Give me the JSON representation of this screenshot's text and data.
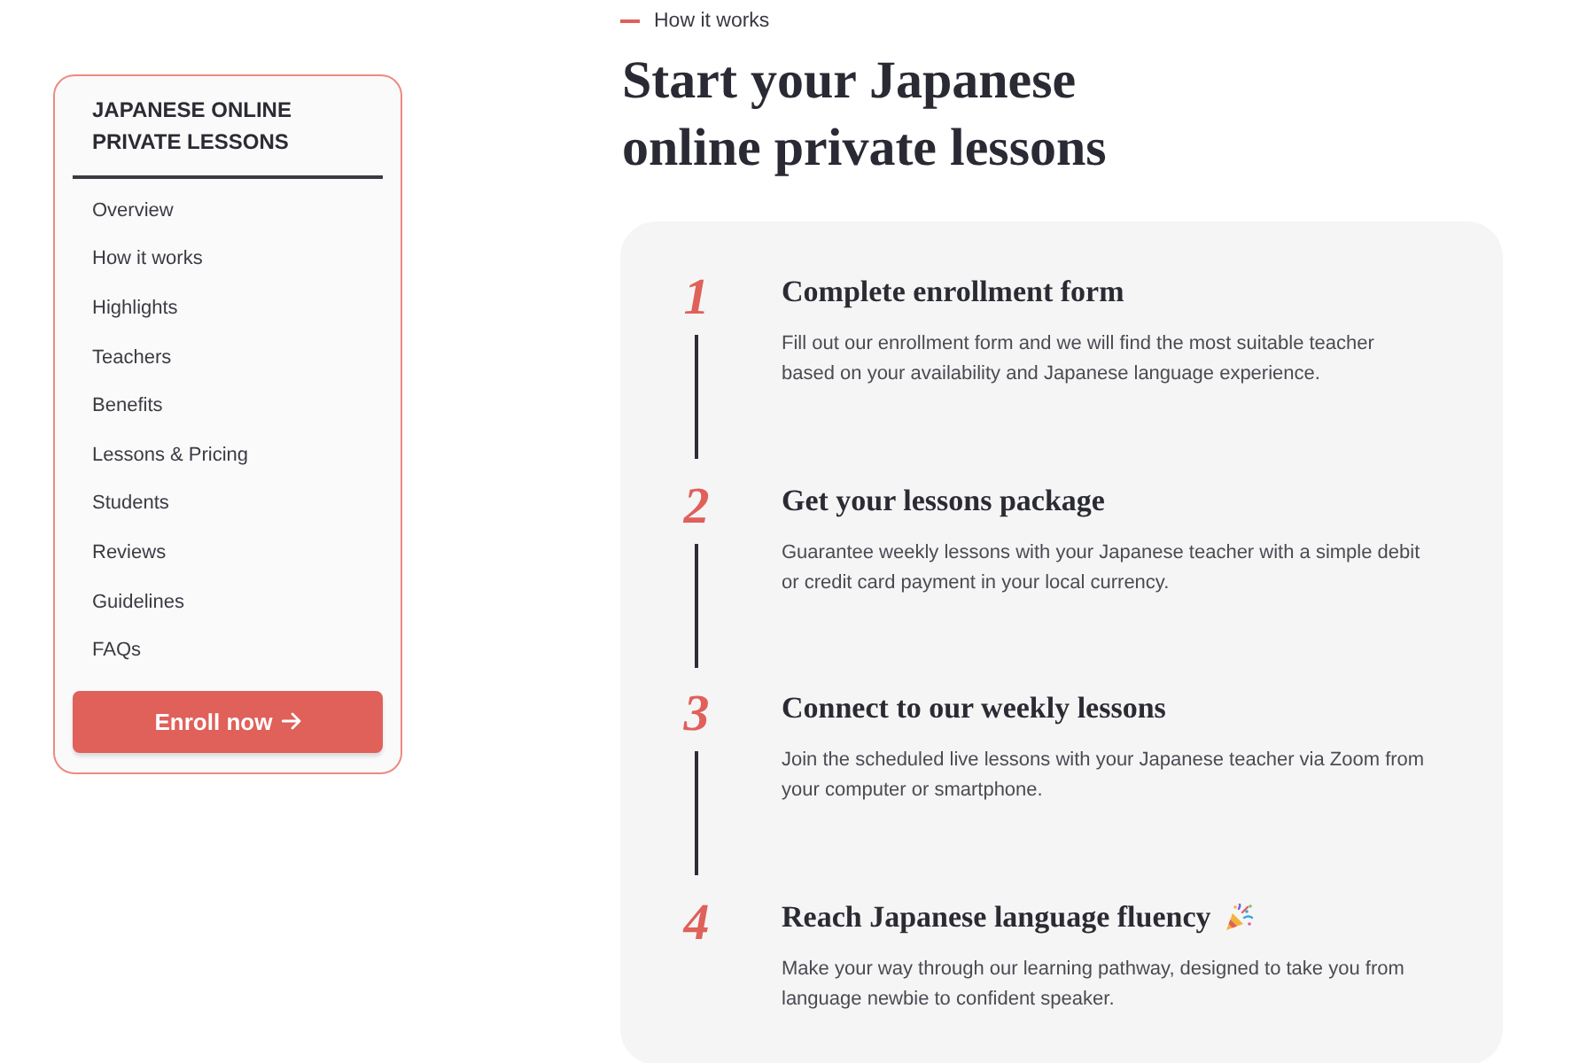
{
  "sidebar": {
    "title": "JAPANESE ONLINE PRIVATE LESSONS",
    "items": [
      "Overview",
      "How it works",
      "Highlights",
      "Teachers",
      "Benefits",
      "Lessons & Pricing",
      "Students",
      "Reviews",
      "Guidelines",
      "FAQs"
    ],
    "button": {
      "label": "Enroll now"
    }
  },
  "eyebrow": "How it works",
  "heading": "Start your Japanese online private lessons",
  "steps": [
    {
      "number": "1",
      "title": "Complete enrollment form",
      "description": "Fill out our enrollment form and we will find the most suitable teacher based on your availability and Japanese language experience.",
      "celebration": false
    },
    {
      "number": "2",
      "title": "Get your lessons package",
      "description": "Guarantee weekly lessons with your Japanese teacher with a simple debit or credit card payment in your local currency.",
      "celebration": false
    },
    {
      "number": "3",
      "title": "Connect to our weekly lessons",
      "description": "Join the scheduled live lessons with your Japanese teacher via Zoom from your computer or smartphone.",
      "celebration": false
    },
    {
      "number": "4",
      "title": "Reach Japanese language fluency",
      "description": "Make your way through our learning pathway, designed to take you from language newbie to confident speaker.",
      "celebration": true
    }
  ]
}
